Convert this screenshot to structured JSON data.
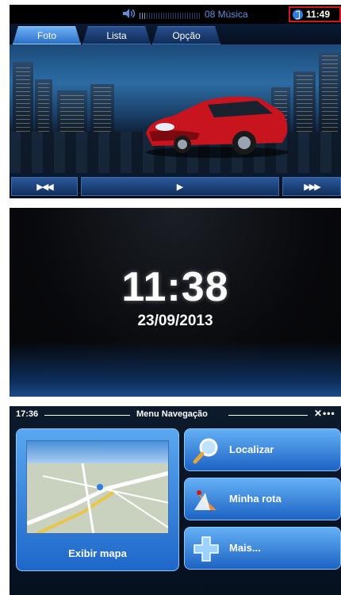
{
  "media": {
    "track_label": "08 Música",
    "volume_level": 0.12,
    "clock": "11:49",
    "tabs": [
      {
        "label": "Foto",
        "active": true
      },
      {
        "label": "Lista",
        "active": false
      },
      {
        "label": "Opção",
        "active": false
      }
    ],
    "controls": {
      "prev_icon": "skip-previous-icon",
      "play_icon": "play-icon",
      "next_icon": "skip-next-icon",
      "prev_glyph": "▶◀◀",
      "play_glyph": "▶",
      "next_glyph": "▶▶▶"
    },
    "accent_color": "#2a6fc8",
    "highlight_color": "#d01818"
  },
  "clock_screen": {
    "time": "11:38",
    "date": "23/09/2013"
  },
  "navigation": {
    "time": "17:36",
    "title": "Menu Navegação",
    "gps_indicator": "satellite-icon",
    "map_button": {
      "label": "Exibir mapa",
      "icon": "map-preview"
    },
    "menu": [
      {
        "label": "Localizar",
        "icon": "magnifier-icon"
      },
      {
        "label": "Minha rota",
        "icon": "route-icon"
      },
      {
        "label": "Mais...",
        "icon": "plus-icon"
      }
    ]
  }
}
